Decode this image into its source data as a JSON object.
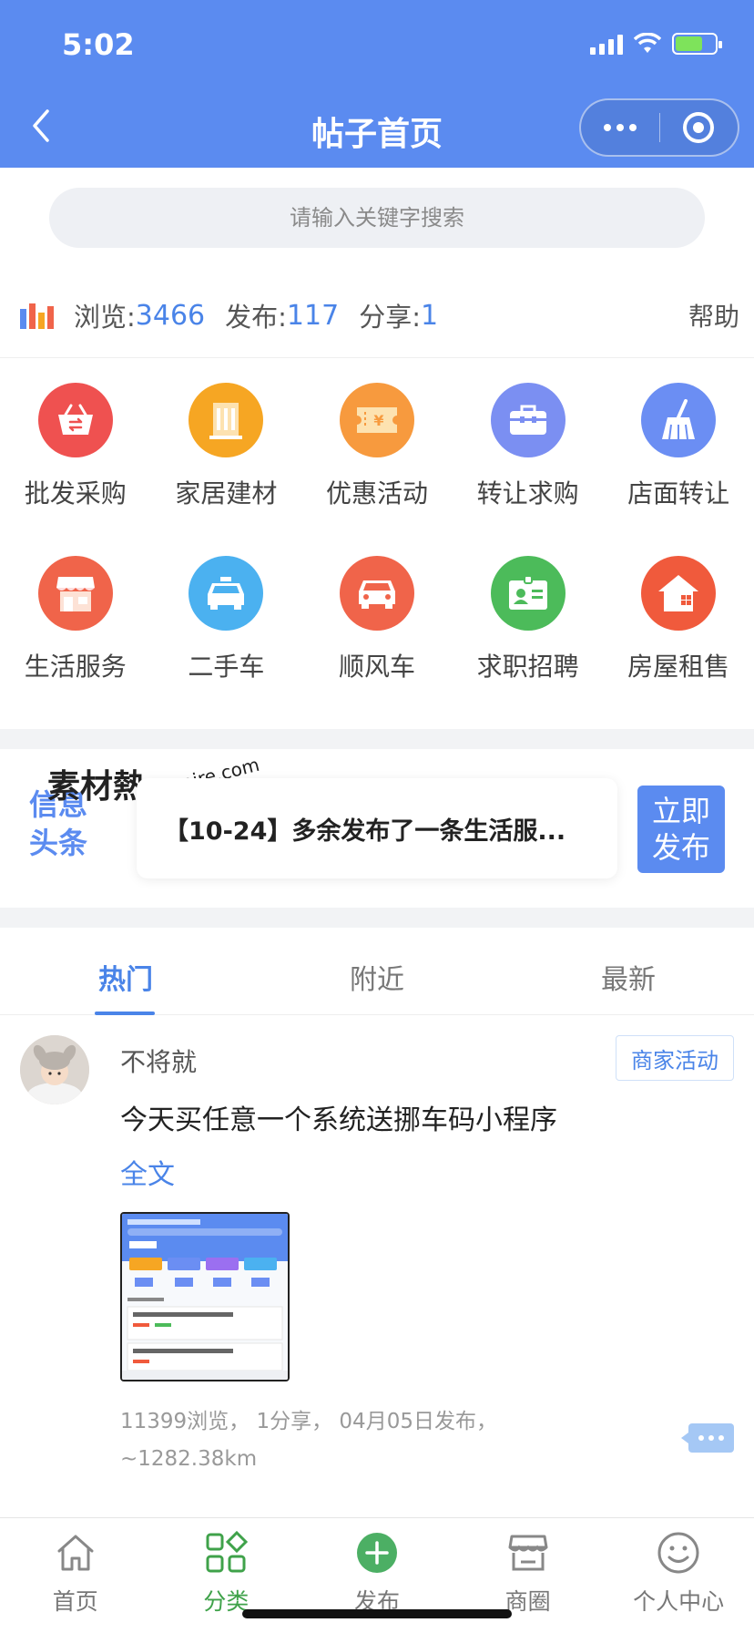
{
  "status_bar": {
    "time": "5:02"
  },
  "header": {
    "title": "帖子首页"
  },
  "search": {
    "placeholder": "请输入关键字搜索"
  },
  "stats": {
    "views_label": "浏览:",
    "views_value": "3466",
    "posts_label": "发布:",
    "posts_value": "117",
    "shares_label": "分享:",
    "shares_value": "1",
    "help": "帮助"
  },
  "categories": [
    {
      "label": "批发采购",
      "icon": "basket-icon",
      "color": "#ef5150"
    },
    {
      "label": "家居建材",
      "icon": "building-icon",
      "color": "#f6a623"
    },
    {
      "label": "优惠活动",
      "icon": "ticket-icon",
      "color": "#f79a3e"
    },
    {
      "label": "转让求购",
      "icon": "briefcase-icon",
      "color": "#7b8ff2"
    },
    {
      "label": "店面转让",
      "icon": "broom-icon",
      "color": "#6b8ef3"
    },
    {
      "label": "生活服务",
      "icon": "shop-icon",
      "color": "#f0644a"
    },
    {
      "label": "二手车",
      "icon": "taxi-icon",
      "color": "#4bb1f0"
    },
    {
      "label": "顺风车",
      "icon": "car-icon",
      "color": "#f0644a"
    },
    {
      "label": "求职招聘",
      "icon": "id-card-icon",
      "color": "#4cbb5a"
    },
    {
      "label": "房屋租售",
      "icon": "house-icon",
      "color": "#f05a3c"
    }
  ],
  "headline": {
    "tag": "信息头条",
    "watermark": {
      "brand": "素材熱",
      "url": "sucaire.com"
    },
    "news": "【10-24】多余发布了一条生活服...",
    "publish_button": "立即发布"
  },
  "tabs": [
    {
      "label": "热门",
      "active": true
    },
    {
      "label": "附近",
      "active": false
    },
    {
      "label": "最新",
      "active": false
    }
  ],
  "post": {
    "author": "不将就",
    "tag": "商家活动",
    "content": "今天买任意一个系统送挪车码小程序",
    "full_text": "全文",
    "meta": "11399浏览，  1分享，  04月05日发布，",
    "distance": "~1282.38km"
  },
  "bottom_nav": [
    {
      "label": "首页",
      "icon": "home-icon",
      "active": false
    },
    {
      "label": "分类",
      "icon": "category-icon",
      "active": true
    },
    {
      "label": "发布",
      "icon": "plus-circle-icon",
      "active": false
    },
    {
      "label": "商圈",
      "icon": "store-icon",
      "active": false
    },
    {
      "label": "个人中心",
      "icon": "smile-icon",
      "active": false
    }
  ],
  "colors": {
    "primary": "#5b8bf0",
    "accent_blue": "#4a84e8",
    "active_green": "#3fa24a"
  }
}
